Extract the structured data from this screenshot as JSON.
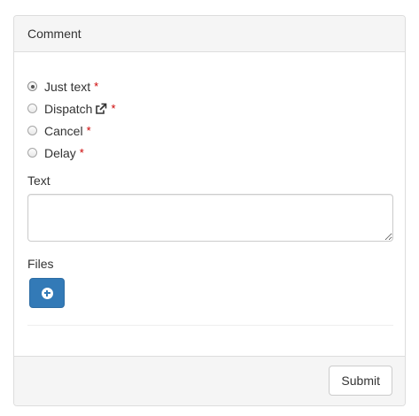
{
  "panel": {
    "title": "Comment"
  },
  "form": {
    "radio_options": [
      {
        "label": "Just text",
        "required_mark": "*",
        "checked": true
      },
      {
        "label": "Dispatch",
        "required_mark": "*",
        "checked": false,
        "icon": "external-link-icon"
      },
      {
        "label": "Cancel",
        "required_mark": "*",
        "checked": false
      },
      {
        "label": "Delay",
        "required_mark": "*",
        "checked": false
      }
    ],
    "text_label": "Text",
    "text_value": "",
    "files_label": "Files",
    "add_file_icon": "plus-circle-icon"
  },
  "footer": {
    "submit_label": "Submit"
  },
  "colors": {
    "primary": "#337ab7",
    "required": "#cc0000",
    "panel_bg": "#f5f5f5",
    "border": "#dddddd"
  }
}
